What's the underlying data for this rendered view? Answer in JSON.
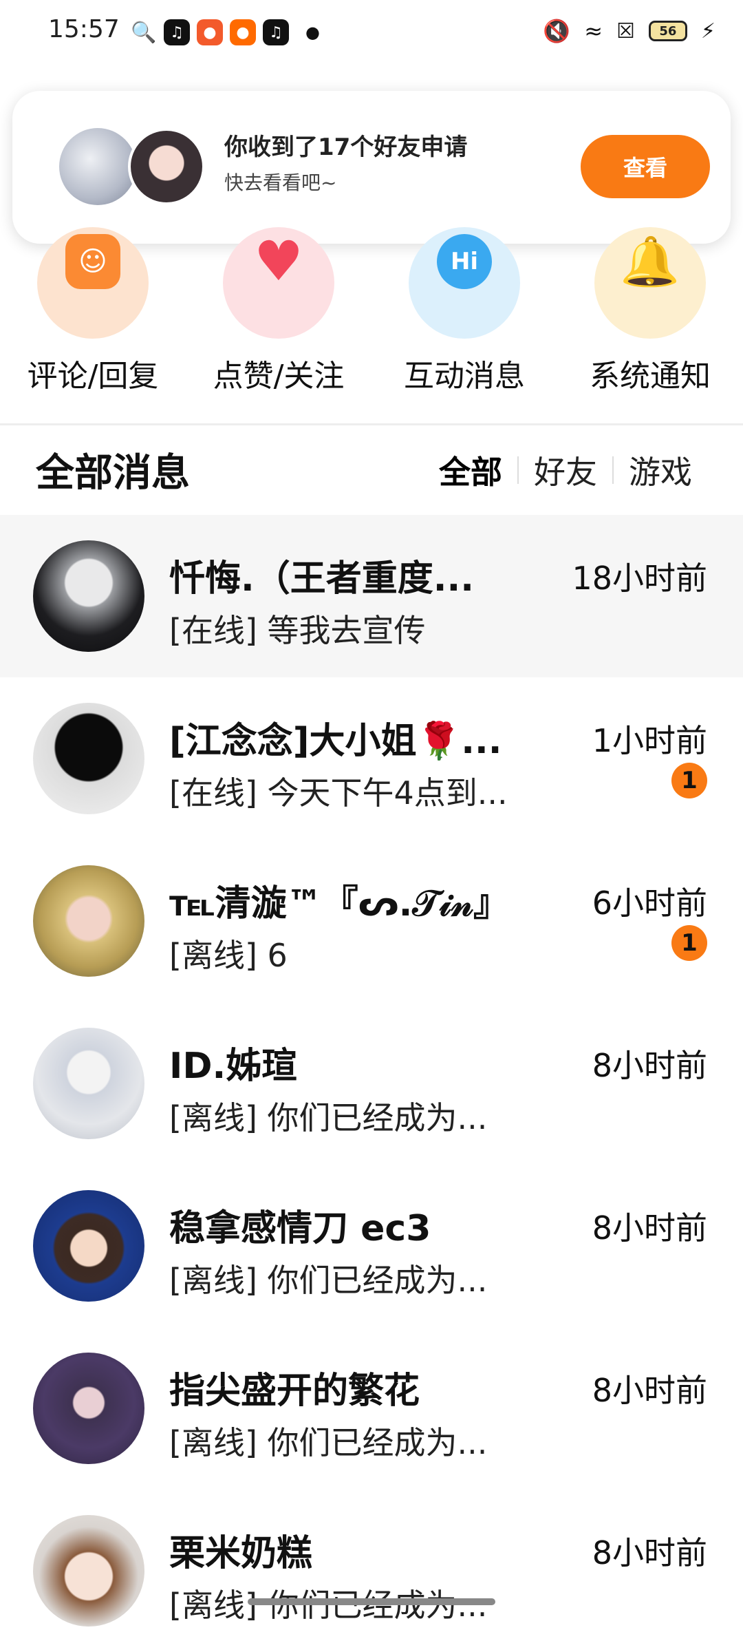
{
  "status_bar": {
    "time": "15:57",
    "battery": "56",
    "apps": [
      "search-icon",
      "tiktok-icon",
      "app-red-icon",
      "app-orange-icon",
      "tiktok-icon"
    ]
  },
  "friend_notice": {
    "title": "你收到了17个好友申请",
    "subtitle": "快去看看吧~",
    "button": "查看"
  },
  "categories": [
    {
      "label": "评论/回复",
      "icon": "comment-smile-icon"
    },
    {
      "label": "点赞/关注",
      "icon": "heart-icon"
    },
    {
      "label": "互动消息",
      "icon": "hi-bubble-icon"
    },
    {
      "label": "系统通知",
      "icon": "bell-icon"
    }
  ],
  "messages_section": {
    "title": "全部消息",
    "filters": [
      "全部",
      "好友",
      "游戏"
    ]
  },
  "messages": [
    {
      "name": "忏悔.（王者重度...",
      "preview": "[在线] 等我去宣传",
      "time": "18小时前",
      "badge": ""
    },
    {
      "name": "[江念念]大小姐🌹...",
      "preview": "[在线] 今天下午4点到...",
      "time": "1小时前",
      "badge": "1"
    },
    {
      "name": "℡清漩™『ᔕ.𝒯𝒾𝓃』",
      "preview": "[离线] 6",
      "time": "6小时前",
      "badge": "1"
    },
    {
      "name": "ID.姊瑄",
      "preview": "[离线] 你们已经成为...",
      "time": "8小时前",
      "badge": ""
    },
    {
      "name": "稳拿感情刀 ec3",
      "preview": "[离线] 你们已经成为...",
      "time": "8小时前",
      "badge": ""
    },
    {
      "name": "指尖盛开的繁花",
      "preview": "[离线] 你们已经成为...",
      "time": "8小时前",
      "badge": ""
    },
    {
      "name": "栗米奶糕",
      "preview": "[离线] 你们已经成为...",
      "time": "8小时前",
      "badge": ""
    }
  ],
  "colors": {
    "accent": "#f97a14",
    "badge": "#f97a14"
  }
}
